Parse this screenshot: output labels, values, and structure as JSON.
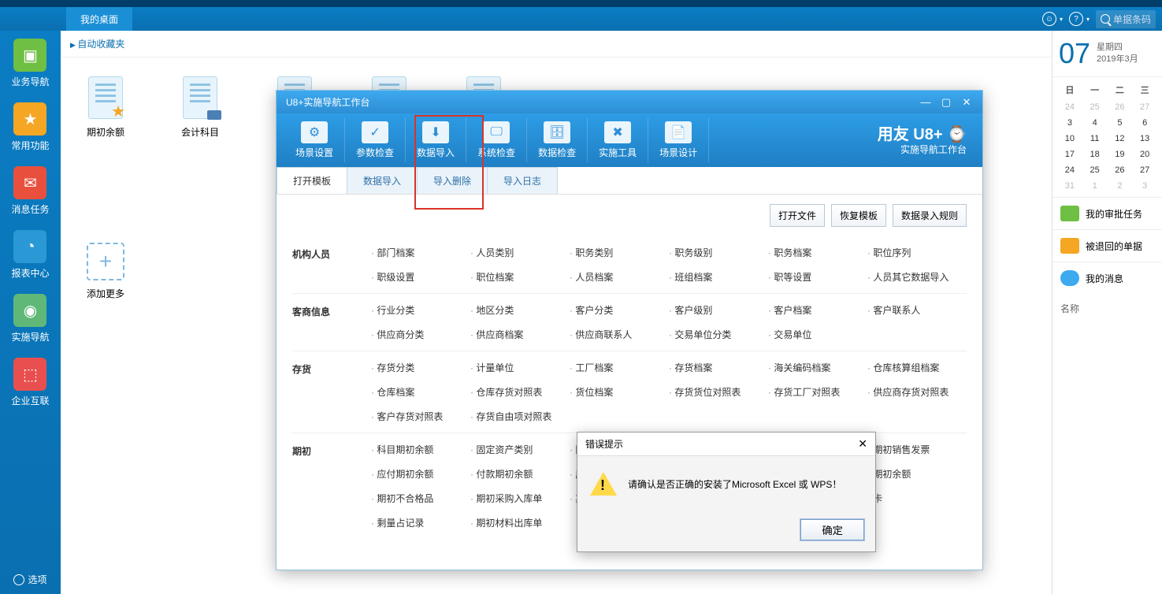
{
  "header": {
    "tab_desktop": "我的桌面",
    "search_placeholder": "单据条码"
  },
  "sidebar": {
    "items": [
      {
        "label": "业务导航"
      },
      {
        "label": "常用功能"
      },
      {
        "label": "消息任务"
      },
      {
        "label": "报表中心"
      },
      {
        "label": "实施导航"
      },
      {
        "label": "企业互联"
      }
    ],
    "options": "选项"
  },
  "desktop": {
    "fav": "自动收藏夹",
    "items": [
      {
        "label": "期初余额"
      },
      {
        "label": "会计科目"
      }
    ],
    "add_more": "添加更多"
  },
  "right": {
    "big_day": "07",
    "weekday": "星期四",
    "yearmonth": "2019年3月",
    "dow": [
      "日",
      "一",
      "二",
      "三"
    ],
    "rows": [
      [
        "24",
        "25",
        "26",
        "27"
      ],
      [
        "3",
        "4",
        "5",
        "6"
      ],
      [
        "10",
        "11",
        "12",
        "13"
      ],
      [
        "17",
        "18",
        "19",
        "20"
      ],
      [
        "24",
        "25",
        "26",
        "27"
      ],
      [
        "31",
        "1",
        "2",
        "3"
      ]
    ],
    "dim_rows": [
      0,
      5
    ],
    "tasks_approve": "我的审批任务",
    "tasks_return": "被退回的单据",
    "tasks_msg": "我的消息",
    "name_label": "名称"
  },
  "modal": {
    "title": "U8+实施导航工作台",
    "toolbar": [
      {
        "label": "场景设置",
        "g": "⚙"
      },
      {
        "label": "参数检查",
        "g": "✓"
      },
      {
        "label": "数据导入",
        "g": "⬇"
      },
      {
        "label": "系统检查",
        "g": "🖵"
      },
      {
        "label": "数据检查",
        "g": "🗄"
      },
      {
        "label": "实施工具",
        "g": "✖"
      },
      {
        "label": "场景设计",
        "g": "📄"
      }
    ],
    "logo_top": "用友 U8+",
    "logo_bottom": "实施导航工作台",
    "tabs": [
      "打开模板",
      "数据导入",
      "导入删除",
      "导入日志"
    ],
    "actions": [
      "打开文件",
      "恢复模板",
      "数据录入规则"
    ],
    "categories": [
      {
        "label": "机构人员",
        "items": [
          "部门档案",
          "人员类别",
          "职务类别",
          "职务级别",
          "职务档案",
          "职位序列",
          "职级设置",
          "职位档案",
          "人员档案",
          "班组档案",
          "职等设置",
          "人员其它数据导入"
        ]
      },
      {
        "label": "客商信息",
        "items": [
          "行业分类",
          "地区分类",
          "客户分类",
          "客户级别",
          "客户档案",
          "客户联系人",
          "供应商分类",
          "供应商档案",
          "供应商联系人",
          "交易单位分类",
          "交易单位"
        ]
      },
      {
        "label": "存货",
        "items": [
          "存货分类",
          "计量单位",
          "工厂档案",
          "存货档案",
          "海关编码档案",
          "仓库核算组档案",
          "仓库档案",
          "仓库存货对照表",
          "货位档案",
          "存货货位对照表",
          "存货工厂对照表",
          "供应商存货对照表",
          "客户存货对照表",
          "存货自由项对照表"
        ]
      },
      {
        "label": "期初",
        "items": [
          "科目期初余额",
          "固定资产类别",
          "固",
          "",
          "",
          "期初销售发票",
          "应付期初余额",
          "付款期初余额",
          "应",
          "",
          "",
          "期初余额",
          "期初不合格品",
          "期初采购入库单",
          "期",
          "",
          "",
          "卡",
          "剩量占记录",
          "期初材料出库单"
        ]
      }
    ]
  },
  "error": {
    "title": "错误提示",
    "message": "请确认是否正确的安装了Microsoft Excel 或 WPS！",
    "ok": "确定"
  }
}
